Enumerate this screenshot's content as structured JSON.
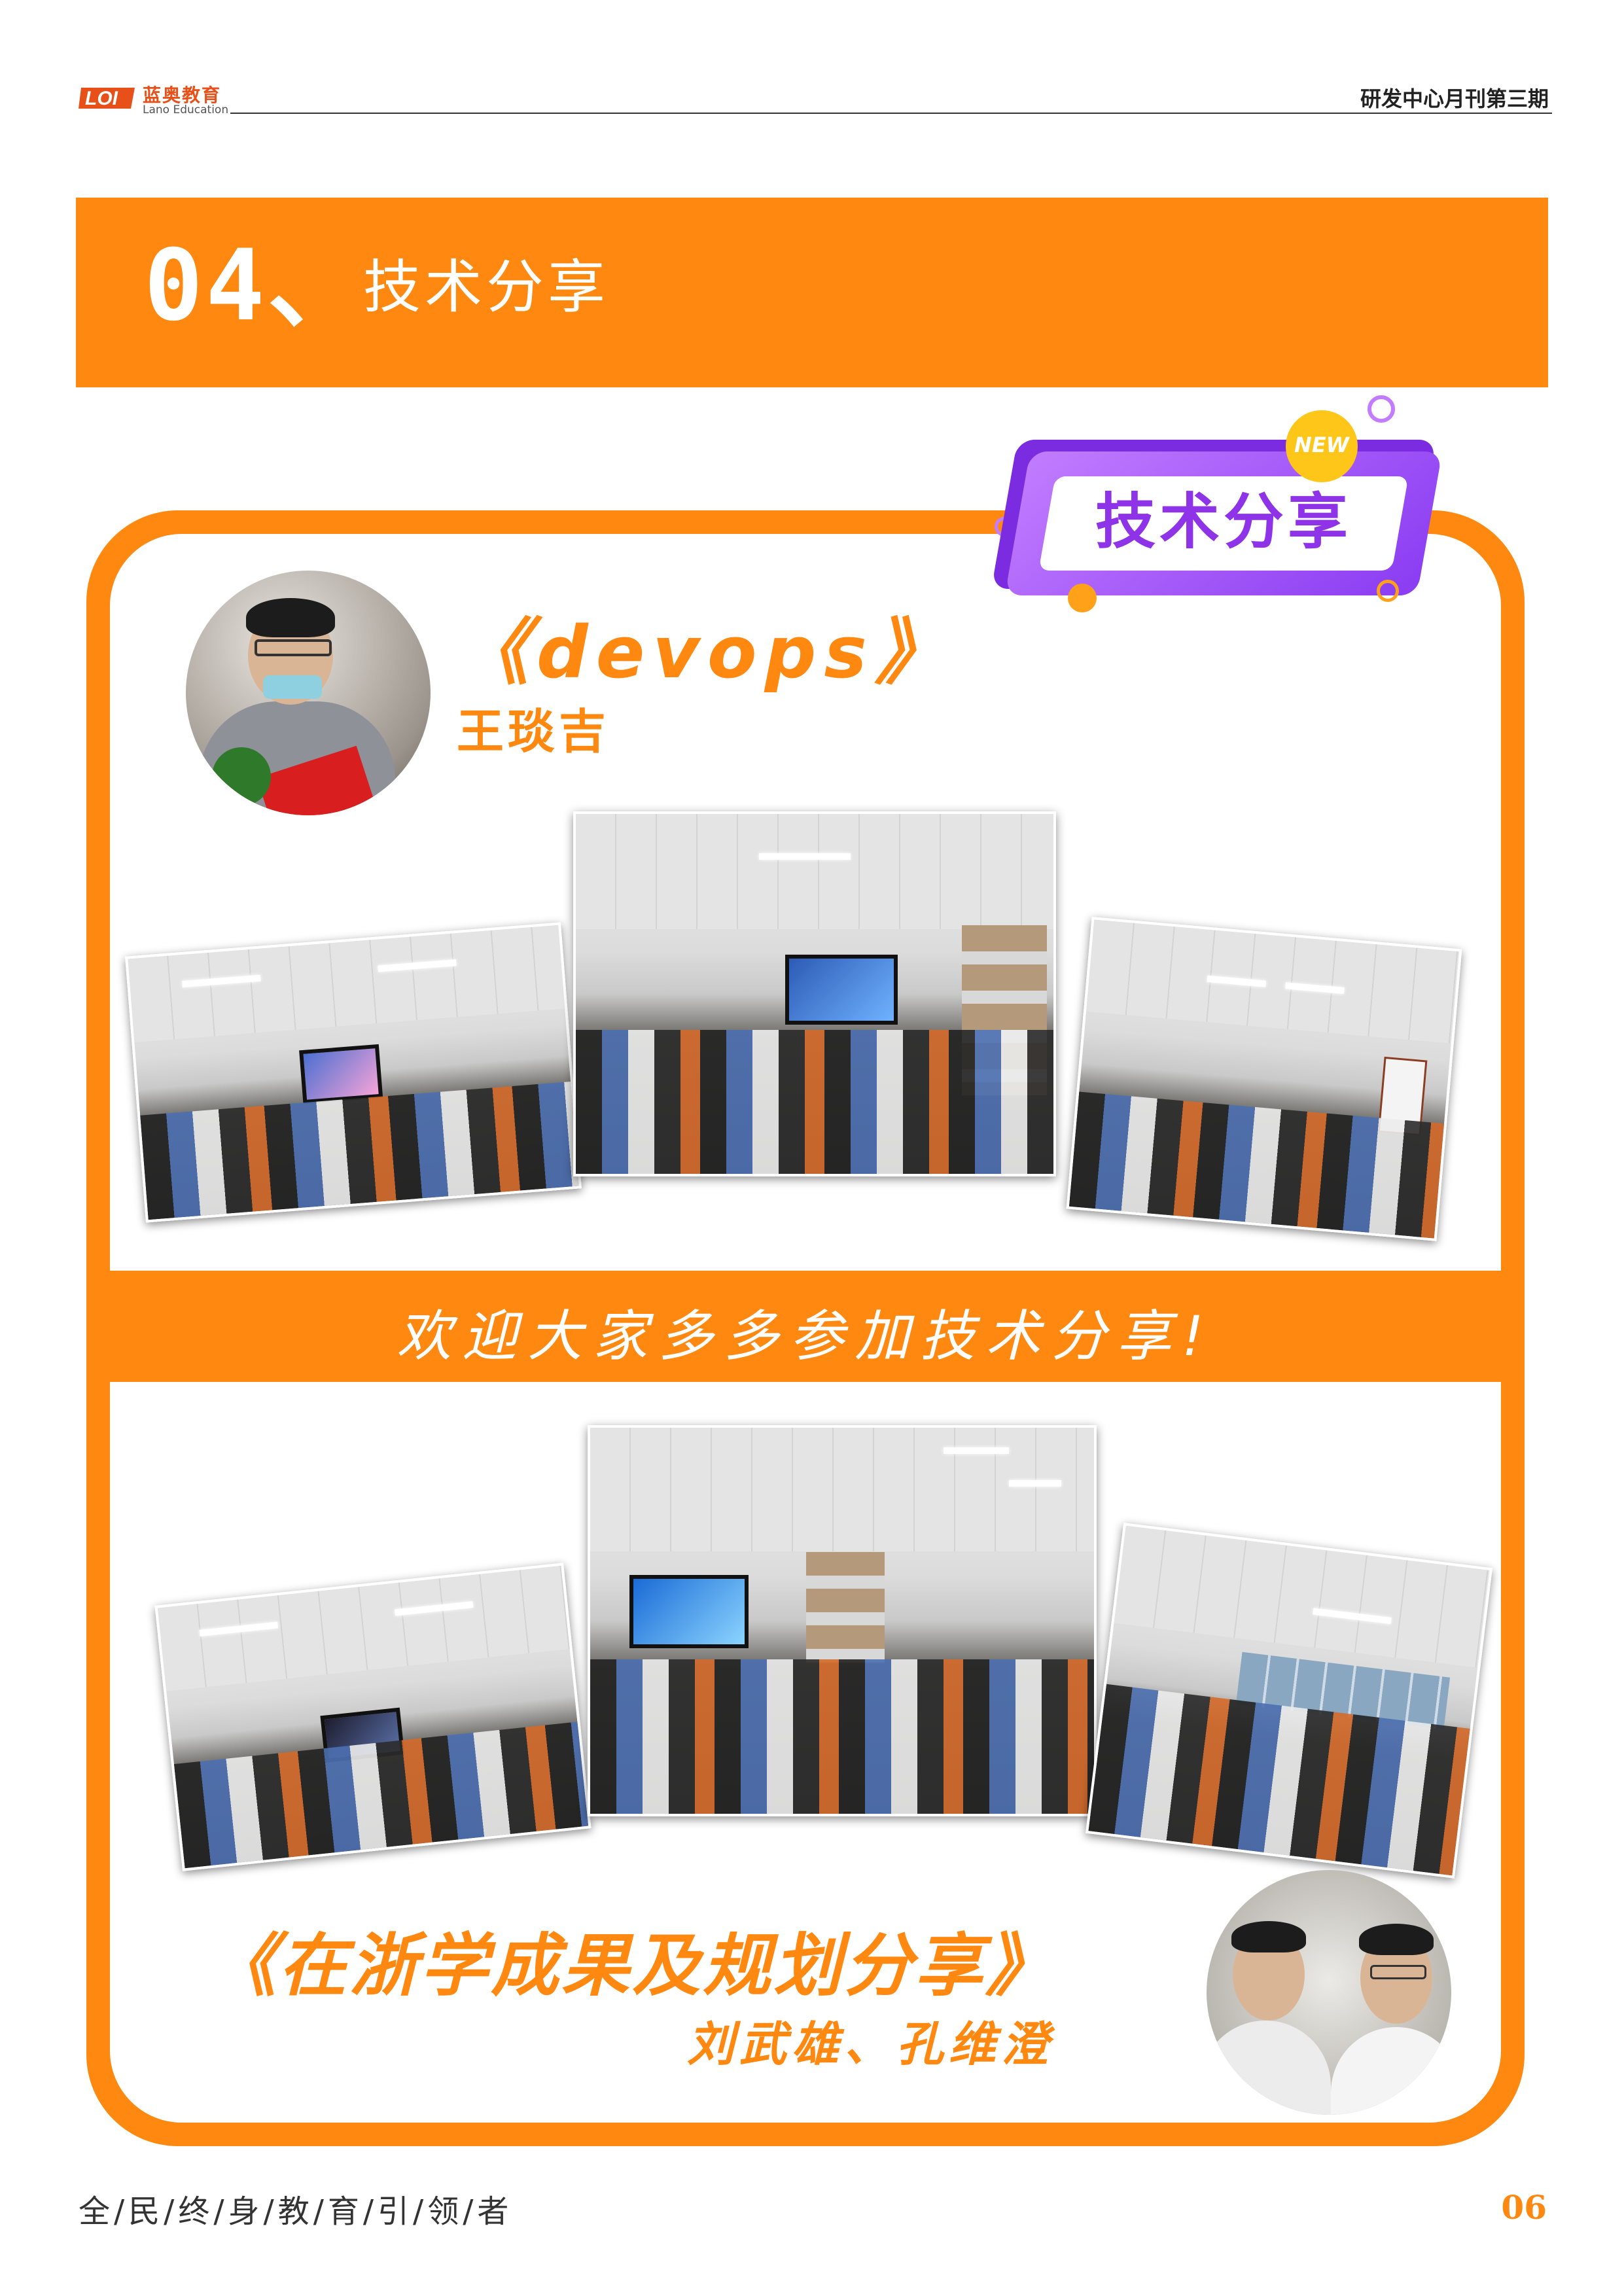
{
  "header": {
    "logo_cn": "蓝奥教育",
    "logo_en": "Lano Education",
    "title": "研发中心月刊第三期"
  },
  "section": {
    "number": "04、",
    "title": "技术分享"
  },
  "badge": {
    "new_label": "NEW",
    "label": "技术分享"
  },
  "talk1": {
    "title": "《devops》",
    "speaker": "王琰吉"
  },
  "welcome": "欢迎大家多多参加技术分享!",
  "talk2": {
    "title": "《在浙学成果及规划分享》",
    "speakers": "刘武雄、孔维澄"
  },
  "footer": {
    "slogan": "全/民/终/身/教/育/引/领/者",
    "page": "06"
  },
  "colors": {
    "accent": "#ff8810",
    "badge_purple": "#8f33e8",
    "badge_yellow": "#ffc61a"
  }
}
